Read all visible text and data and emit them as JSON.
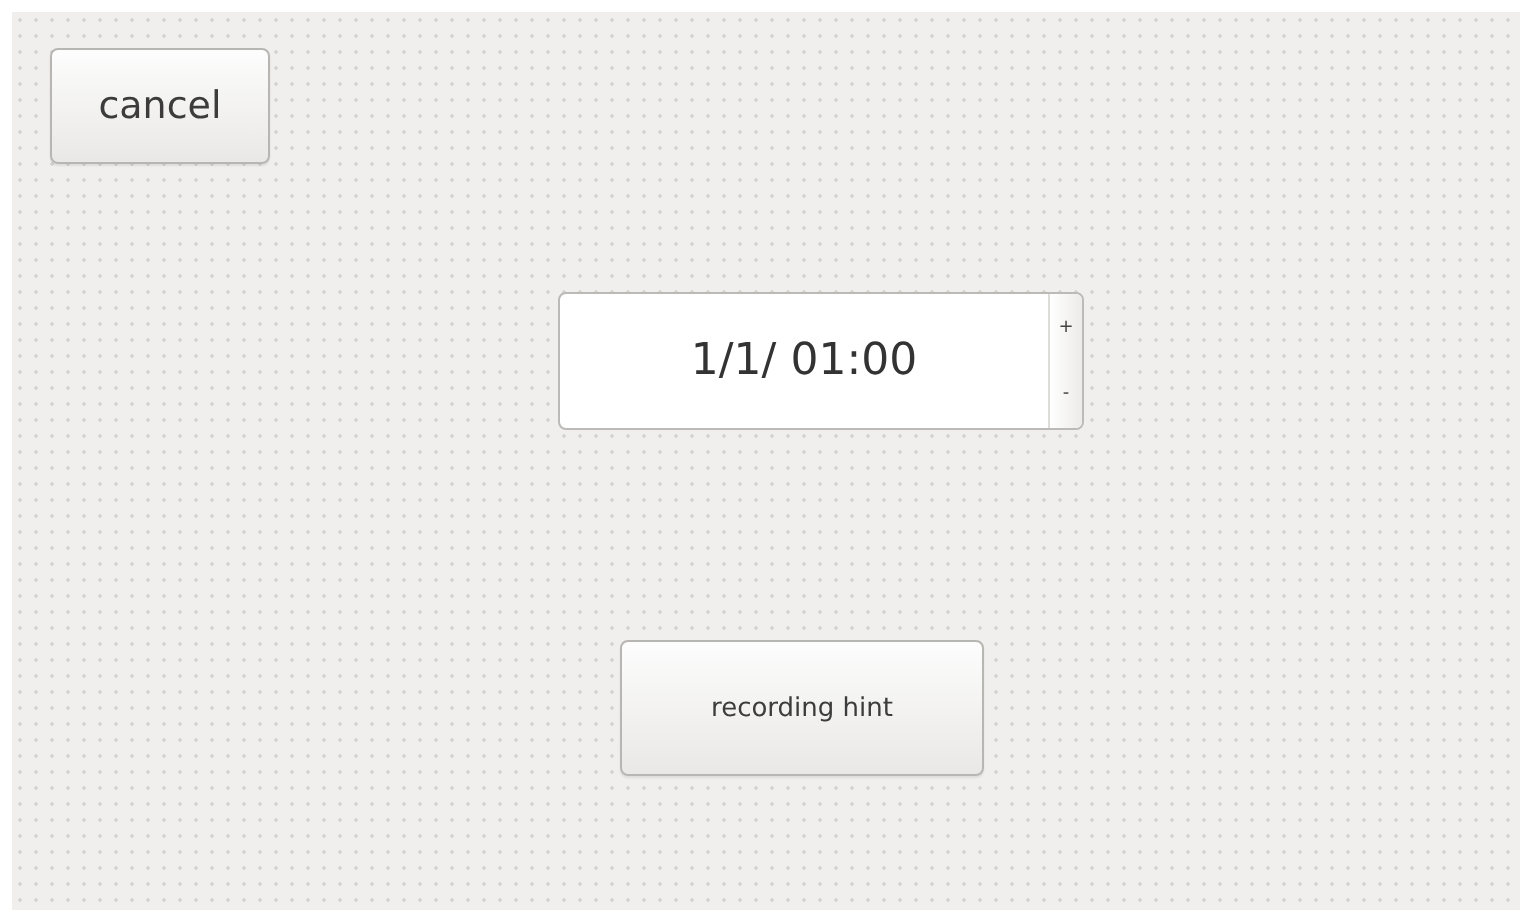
{
  "cancel_button": {
    "label": "cancel"
  },
  "time_spinbox": {
    "value": "1/1/ 01:00",
    "increment": "+",
    "decrement": "-"
  },
  "hint_button": {
    "label": "recording hint"
  }
}
